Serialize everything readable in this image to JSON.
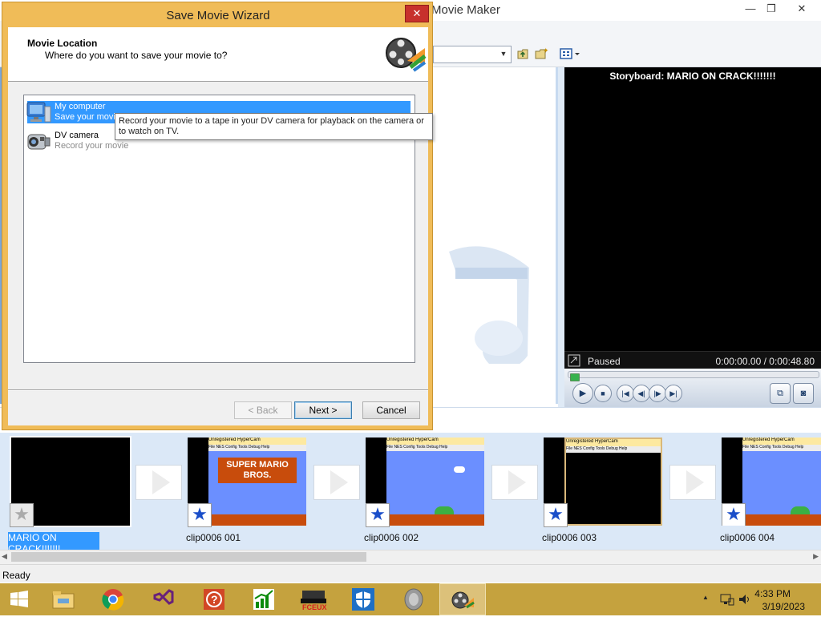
{
  "main_window": {
    "title": "Movie Maker",
    "minimize_icon": "minimize-icon",
    "restore_icon": "restore-icon",
    "close_icon": "close-icon",
    "minimize_glyph": "—",
    "restore_glyph": "❐",
    "close_glyph": "✕"
  },
  "preview": {
    "title": "Storyboard: MARIO ON CRACK!!!!!!!",
    "status": "Paused",
    "time": "0:00:00.00 / 0:00:48.80",
    "seek_fraction": 0.0
  },
  "storyboard": {
    "clips": [
      {
        "label": "MARIO ON CRACK!!!!!!!",
        "selected": true,
        "frame": "black-title"
      },
      {
        "label": "clip0006 001",
        "selected": false,
        "frame": "mario-title"
      },
      {
        "label": "clip0006 002",
        "selected": false,
        "frame": "mario-level"
      },
      {
        "label": "clip0006 003",
        "selected": false,
        "frame": "black"
      },
      {
        "label": "clip0006 004",
        "selected": false,
        "frame": "mario-level"
      }
    ],
    "thumb_header": "Unregistered HyperCam",
    "thumb_menu": "File NES Config Tools Debug Help",
    "mario_title": "SUPER MARIO BROS."
  },
  "status_bar": {
    "text": "Ready"
  },
  "dialog": {
    "title": "Save Movie Wizard",
    "close_glyph": "✕",
    "heading": "Movie Location",
    "subheading": "Where do you want to save your movie to?",
    "options": [
      {
        "title": "My computer",
        "description": "Save your movie for playback on your computer.",
        "selected": true
      },
      {
        "title": "DV camera",
        "description": "Record your movie",
        "selected": false
      }
    ],
    "tooltip": "Record your movie to a tape in your DV camera for playback on the camera or to watch on TV.",
    "buttons": {
      "back": "< Back",
      "next": "Next >",
      "cancel": "Cancel"
    }
  },
  "taskbar": {
    "items": [
      "start-icon",
      "file-explorer-icon",
      "chrome-icon",
      "visual-studio-icon",
      "help-icon",
      "stock-chart-icon",
      "fceux-icon",
      "defender-shield-icon",
      "speaker-icon",
      "movie-maker-icon"
    ],
    "time": "4:33 PM",
    "date": "3/19/2023",
    "tray_icons": [
      "tray-up-arrow-icon",
      "network-icon",
      "volume-icon"
    ]
  },
  "colors": {
    "dialog_border": "#f0bc58",
    "selection": "#3399ff",
    "taskbar": "#c5a23e",
    "close_red": "#c7312c"
  }
}
